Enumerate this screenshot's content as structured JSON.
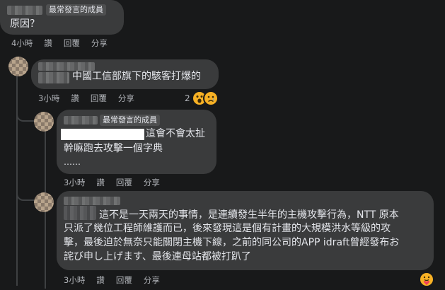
{
  "comments": [
    {
      "badge": "最常發言的成員",
      "text_lines": [
        "原因？"
      ],
      "actions": {
        "time": "4小時",
        "like": "讚",
        "reply": "回覆",
        "share": "分享"
      }
    },
    {
      "text_lines": [
        "中國工信部旗下的駭客打爆的"
      ],
      "actions": {
        "time": "3小時",
        "like": "讚",
        "reply": "回覆",
        "share": "分享"
      },
      "reactions": {
        "count": "2",
        "icons": [
          "wow-reaction-icon",
          "sad-reaction-icon"
        ]
      }
    },
    {
      "badge": "最常發言的成員",
      "text_lines": [
        "這會不會太扯",
        "幹嘛跑去攻擊一個字典",
        "……"
      ],
      "actions": {
        "time": "3小時",
        "like": "讚",
        "reply": "回覆",
        "share": "分享"
      }
    },
    {
      "text_lines": [
        "這不是一天兩天的事情，是連續發生半年的主機攻擊行為，NTT 原本",
        "只派了幾位工程師維護而已，後來發現這是個有計畫的大規模洪水等級的攻",
        "擊，最後迫於無奈只能關閉主機下線，之前的同公司的APP idraft曾經發布お",
        "詫び申し上げます、最後連母站都被打趴了"
      ],
      "actions": {
        "time": "3小時",
        "like": "讚",
        "reply": "回覆",
        "share": "分享"
      },
      "reactions": {
        "icons": [
          "care-reaction-icon"
        ]
      }
    }
  ],
  "colors": {
    "background": "#18191a",
    "bubble": "#3a3b3c",
    "text": "#e4e6eb",
    "muted": "#b0b3b8",
    "badge": "#4e4f50"
  }
}
